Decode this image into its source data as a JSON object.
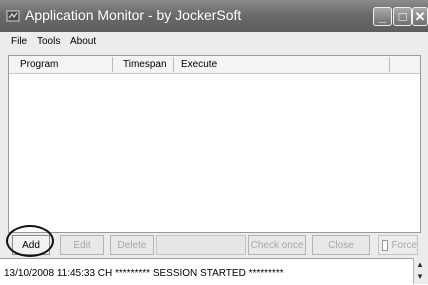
{
  "window": {
    "title": "Application Monitor - by JockerSoft"
  },
  "titlebar_buttons": {
    "minimize": "_",
    "maximize": "□",
    "close": "✕"
  },
  "menu": [
    "File",
    "Tools",
    "About"
  ],
  "columns": [
    "Program",
    "Timespan",
    "Execute"
  ],
  "buttons": {
    "add": "Add",
    "edit": "Edit",
    "delete": "Delete",
    "check_once": "Check once",
    "close": "Close",
    "force": "Force"
  },
  "log": {
    "line": "13/10/2008 11:45:33 CH   ********* SESSION STARTED *********"
  },
  "icons": {
    "app": "app-icon",
    "scroll_up": "up-arrow-icon",
    "scroll_down": "down-arrow-icon"
  }
}
